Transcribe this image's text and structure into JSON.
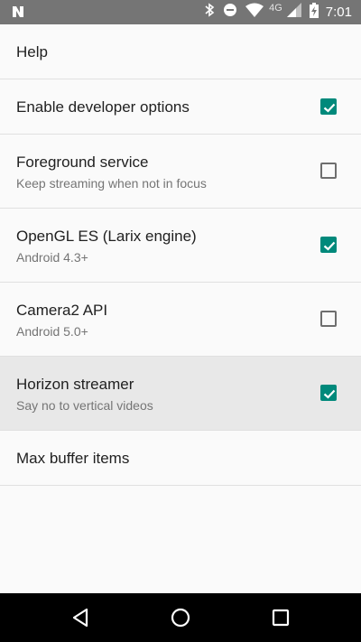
{
  "status_bar": {
    "time": "7:01",
    "network": "4G",
    "icons": [
      "notification-n-icon",
      "bluetooth-icon",
      "do-not-disturb-icon",
      "wifi-icon",
      "cell-signal-icon",
      "battery-charging-icon"
    ]
  },
  "settings": [
    {
      "title": "Help",
      "summary": null,
      "checkbox": null
    },
    {
      "title": "Enable developer options",
      "summary": null,
      "checkbox": true
    },
    {
      "title": "Foreground service",
      "summary": "Keep streaming when not in focus",
      "checkbox": false
    },
    {
      "title": "OpenGL ES (Larix engine)",
      "summary": "Android 4.3+",
      "checkbox": true
    },
    {
      "title": "Camera2 API",
      "summary": "Android 5.0+",
      "checkbox": false
    },
    {
      "title": "Horizon streamer",
      "summary": "Say no to vertical videos",
      "checkbox": true
    },
    {
      "title": "Max buffer items",
      "summary": null,
      "checkbox": null
    }
  ],
  "colors": {
    "accent": "#00897b",
    "status_bar": "#757575",
    "nav_bar": "#000000"
  }
}
